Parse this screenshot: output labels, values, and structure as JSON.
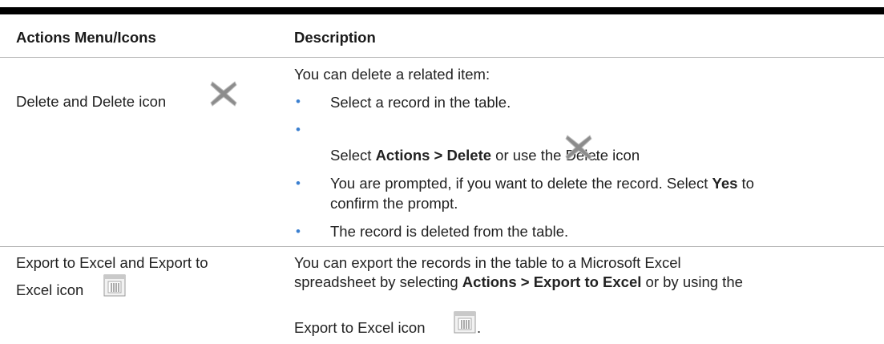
{
  "table": {
    "headers": [
      "Actions Menu/Icons",
      "Description"
    ],
    "rows": [
      {
        "action": "Delete and Delete icon",
        "icon": "delete-x-icon",
        "intro": "You can delete a related item:",
        "bullets": [
          "Select a record in the table.",
          "",
          "You are prompted, if you want to delete the record. Select",
          "The record is deleted from the table."
        ],
        "step2": {
          "pre": "Select ",
          "bold": "Actions > Delete",
          "post": " or use the Delete icon",
          "end": "."
        },
        "step3": {
          "bold": "Yes",
          "post": " to",
          "line2": "confirm the prompt."
        }
      },
      {
        "action_line1": "Export to Excel and Export to",
        "action_line2": "Excel icon",
        "icon": "excel-spreadsheet-icon",
        "desc_line1": "You can export the records in the table to a Microsoft Excel",
        "desc_line2_pre": "spreadsheet by selecting ",
        "desc_line2_bold": "Actions > Export to Excel",
        "desc_line2_post": " or by using the",
        "desc_line3": "Export to Excel icon",
        "desc_line3_end": "."
      }
    ]
  },
  "colors": {
    "bullet": "#3a7fd0",
    "rule": "#b4b4b4",
    "top_bar": "#000000"
  }
}
